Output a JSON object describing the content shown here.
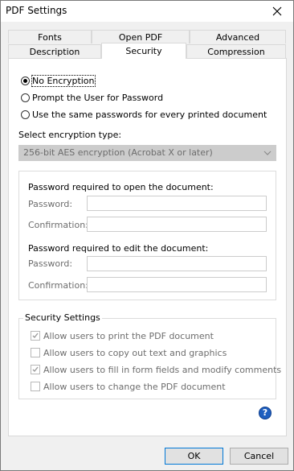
{
  "window": {
    "title": "PDF Settings"
  },
  "tabs": {
    "row1": [
      "Fonts",
      "Open PDF",
      "Advanced"
    ],
    "row2": [
      "Description",
      "Security",
      "Compression"
    ],
    "active": "Security"
  },
  "encryption_options": [
    {
      "label": "No Encryption",
      "checked": true
    },
    {
      "label": "Prompt the User for Password",
      "checked": false
    },
    {
      "label": "Use the same passwords for every printed document",
      "checked": false
    }
  ],
  "encryption_type": {
    "label": "Select encryption type:",
    "value": "256-bit AES encryption (Acrobat X or later)"
  },
  "open_password": {
    "heading": "Password required to open the document:",
    "password_label": "Password:",
    "confirmation_label": "Confirmation:"
  },
  "edit_password": {
    "heading": "Password required to edit the document:",
    "password_label": "Password:",
    "confirmation_label": "Confirmation:"
  },
  "security_settings": {
    "legend": "Security Settings",
    "items": [
      {
        "label": "Allow users to print the PDF document",
        "checked": true
      },
      {
        "label": "Allow users to copy out text and graphics",
        "checked": false
      },
      {
        "label": "Allow users to fill in form fields and modify comments",
        "checked": true
      },
      {
        "label": "Allow users to change the PDF document",
        "checked": false
      }
    ]
  },
  "help_icon": "?",
  "buttons": {
    "ok": "OK",
    "cancel": "Cancel"
  }
}
